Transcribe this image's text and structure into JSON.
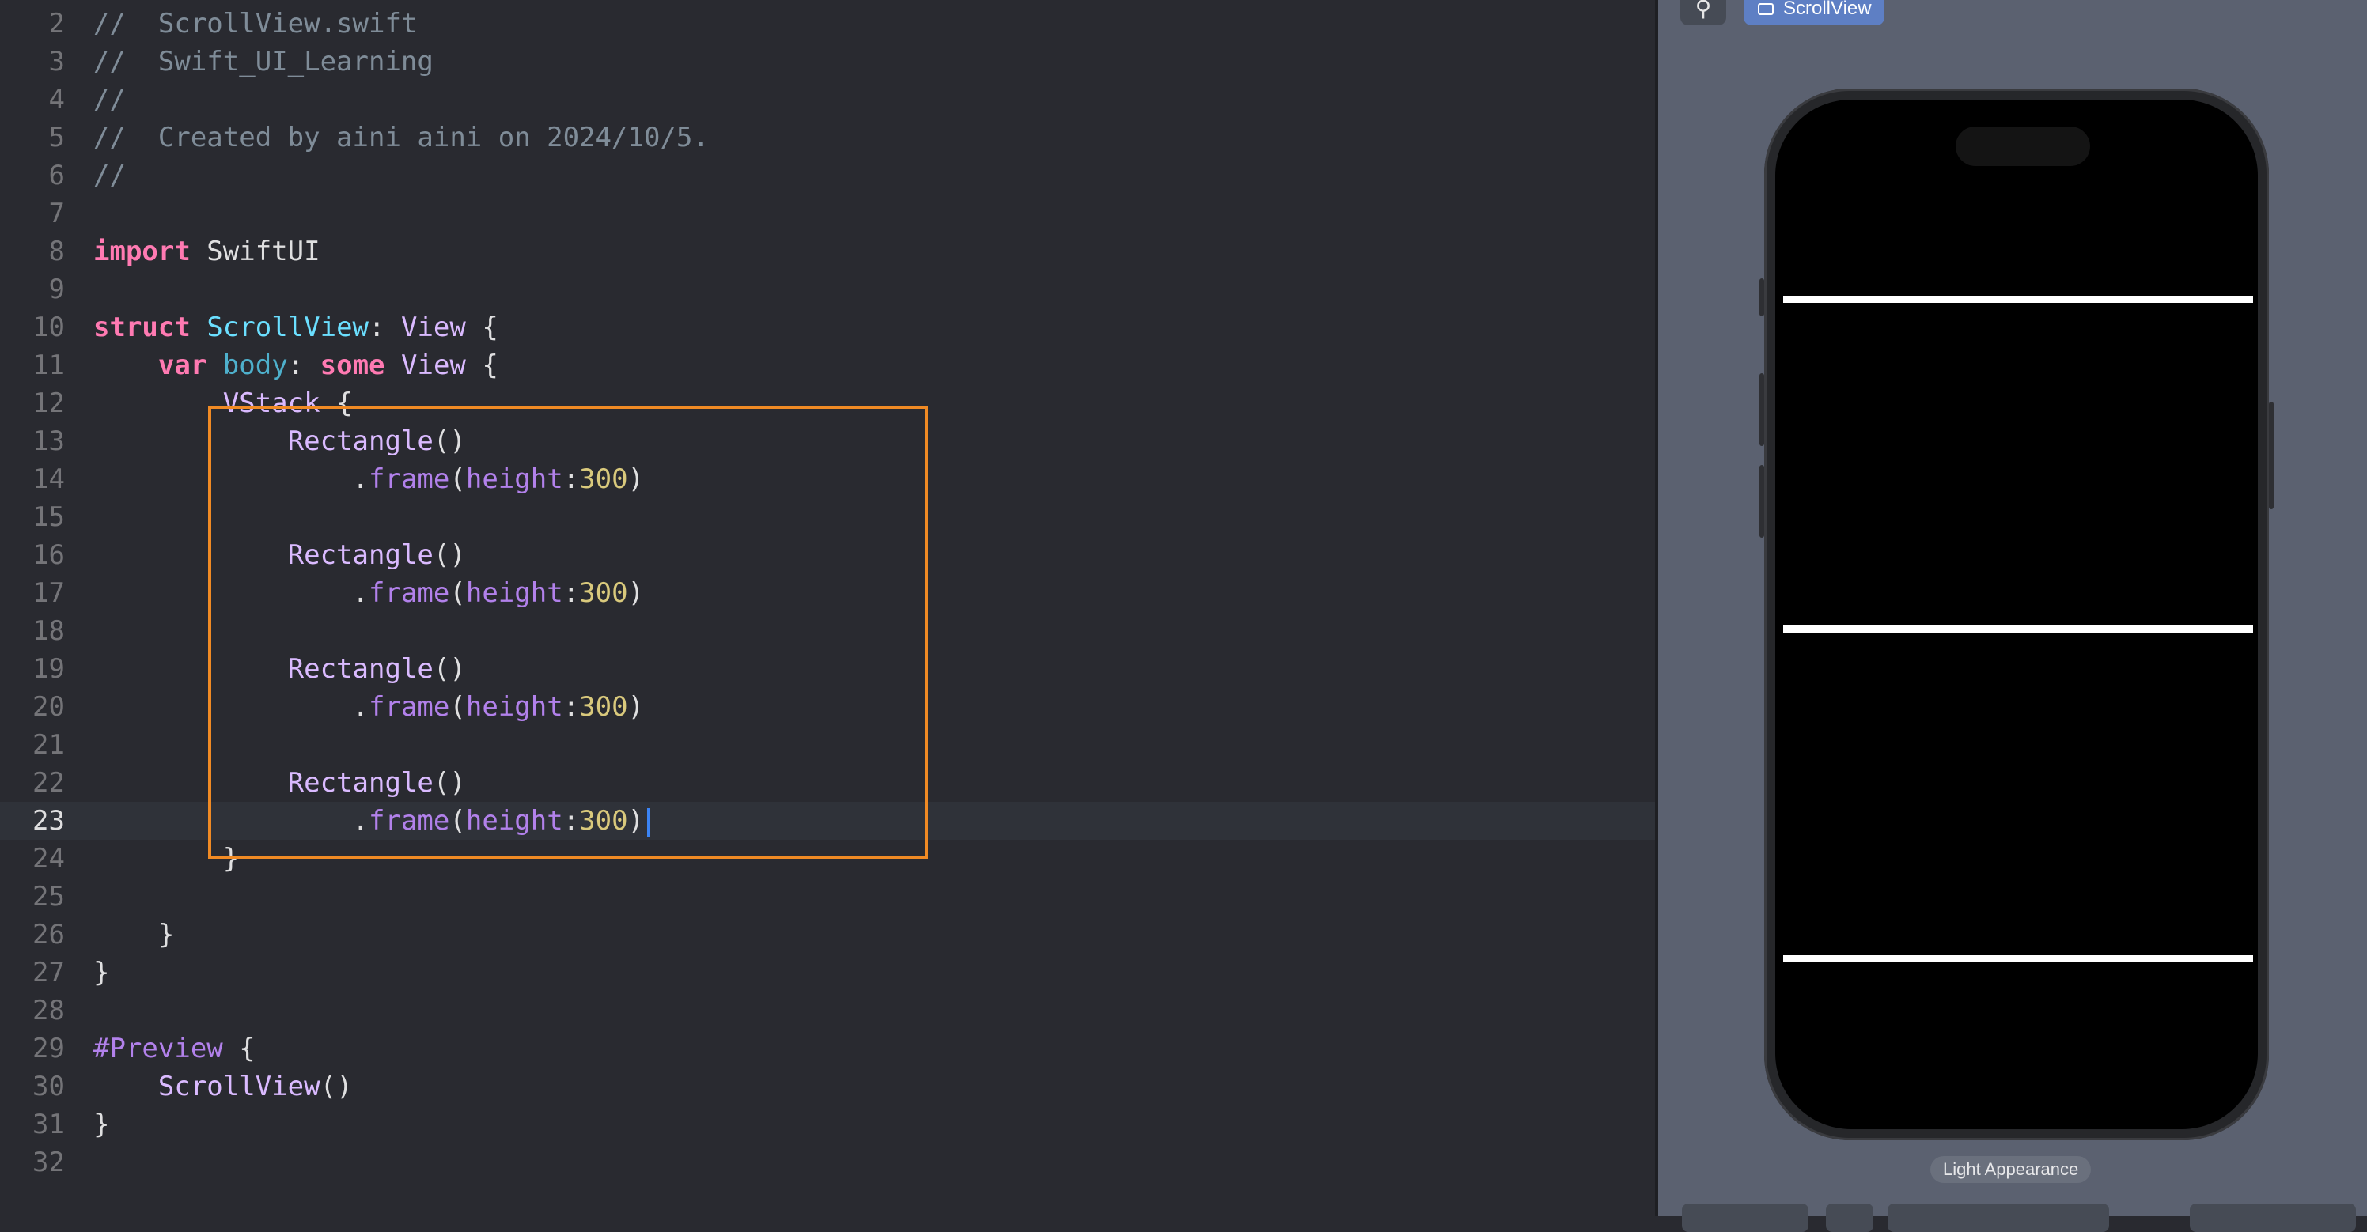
{
  "editor": {
    "current_line": "23",
    "lines": [
      {
        "n": "2",
        "tokens": [
          {
            "c": "t-comment",
            "t": "//  ScrollView.swift"
          }
        ]
      },
      {
        "n": "3",
        "tokens": [
          {
            "c": "t-comment",
            "t": "//  Swift_UI_Learning"
          }
        ]
      },
      {
        "n": "4",
        "tokens": [
          {
            "c": "t-comment",
            "t": "//"
          }
        ]
      },
      {
        "n": "5",
        "tokens": [
          {
            "c": "t-comment",
            "t": "//  Created by aini aini on 2024/10/5."
          }
        ]
      },
      {
        "n": "6",
        "tokens": [
          {
            "c": "t-comment",
            "t": "//"
          }
        ]
      },
      {
        "n": "7",
        "tokens": []
      },
      {
        "n": "8",
        "tokens": [
          {
            "c": "t-kw",
            "t": "import"
          },
          {
            "c": "t-plain",
            "t": " SwiftUI"
          }
        ]
      },
      {
        "n": "9",
        "tokens": []
      },
      {
        "n": "10",
        "tokens": [
          {
            "c": "t-kw",
            "t": "struct"
          },
          {
            "c": "t-plain",
            "t": " "
          },
          {
            "c": "t-type-decl",
            "t": "ScrollView"
          },
          {
            "c": "t-plain",
            "t": ": "
          },
          {
            "c": "t-type",
            "t": "View"
          },
          {
            "c": "t-plain",
            "t": " {"
          }
        ]
      },
      {
        "n": "11",
        "tokens": [
          {
            "c": "t-plain",
            "t": "    "
          },
          {
            "c": "t-kw",
            "t": "var"
          },
          {
            "c": "t-plain",
            "t": " "
          },
          {
            "c": "t-decl",
            "t": "body"
          },
          {
            "c": "t-plain",
            "t": ": "
          },
          {
            "c": "t-kw",
            "t": "some"
          },
          {
            "c": "t-plain",
            "t": " "
          },
          {
            "c": "t-type",
            "t": "View"
          },
          {
            "c": "t-plain",
            "t": " {"
          }
        ]
      },
      {
        "n": "12",
        "tokens": [
          {
            "c": "t-plain",
            "t": "        "
          },
          {
            "c": "t-type",
            "t": "VStack"
          },
          {
            "c": "t-plain",
            "t": " {"
          }
        ]
      },
      {
        "n": "13",
        "tokens": [
          {
            "c": "t-plain",
            "t": "            "
          },
          {
            "c": "t-type",
            "t": "Rectangle"
          },
          {
            "c": "t-plain",
            "t": "()"
          }
        ]
      },
      {
        "n": "14",
        "tokens": [
          {
            "c": "t-plain",
            "t": "                ."
          },
          {
            "c": "t-method",
            "t": "frame"
          },
          {
            "c": "t-plain",
            "t": "("
          },
          {
            "c": "t-param",
            "t": "height"
          },
          {
            "c": "t-plain",
            "t": ":"
          },
          {
            "c": "t-num",
            "t": "300"
          },
          {
            "c": "t-plain",
            "t": ")"
          }
        ]
      },
      {
        "n": "15",
        "tokens": []
      },
      {
        "n": "16",
        "tokens": [
          {
            "c": "t-plain",
            "t": "            "
          },
          {
            "c": "t-type",
            "t": "Rectangle"
          },
          {
            "c": "t-plain",
            "t": "()"
          }
        ]
      },
      {
        "n": "17",
        "tokens": [
          {
            "c": "t-plain",
            "t": "                ."
          },
          {
            "c": "t-method",
            "t": "frame"
          },
          {
            "c": "t-plain",
            "t": "("
          },
          {
            "c": "t-param",
            "t": "height"
          },
          {
            "c": "t-plain",
            "t": ":"
          },
          {
            "c": "t-num",
            "t": "300"
          },
          {
            "c": "t-plain",
            "t": ")"
          }
        ]
      },
      {
        "n": "18",
        "tokens": []
      },
      {
        "n": "19",
        "tokens": [
          {
            "c": "t-plain",
            "t": "            "
          },
          {
            "c": "t-type",
            "t": "Rectangle"
          },
          {
            "c": "t-plain",
            "t": "()"
          }
        ]
      },
      {
        "n": "20",
        "tokens": [
          {
            "c": "t-plain",
            "t": "                ."
          },
          {
            "c": "t-method",
            "t": "frame"
          },
          {
            "c": "t-plain",
            "t": "("
          },
          {
            "c": "t-param",
            "t": "height"
          },
          {
            "c": "t-plain",
            "t": ":"
          },
          {
            "c": "t-num",
            "t": "300"
          },
          {
            "c": "t-plain",
            "t": ")"
          }
        ]
      },
      {
        "n": "21",
        "tokens": []
      },
      {
        "n": "22",
        "tokens": [
          {
            "c": "t-plain",
            "t": "            "
          },
          {
            "c": "t-type",
            "t": "Rectangle"
          },
          {
            "c": "t-plain",
            "t": "()"
          }
        ]
      },
      {
        "n": "23",
        "tokens": [
          {
            "c": "t-plain",
            "t": "                ."
          },
          {
            "c": "t-method",
            "t": "frame"
          },
          {
            "c": "t-plain",
            "t": "("
          },
          {
            "c": "t-param",
            "t": "height"
          },
          {
            "c": "t-plain",
            "t": ":"
          },
          {
            "c": "t-num",
            "t": "300"
          },
          {
            "c": "t-plain",
            "t": ")"
          }
        ]
      },
      {
        "n": "24",
        "tokens": [
          {
            "c": "t-plain",
            "t": "        }"
          }
        ]
      },
      {
        "n": "25",
        "tokens": []
      },
      {
        "n": "26",
        "tokens": [
          {
            "c": "t-plain",
            "t": "    }"
          }
        ]
      },
      {
        "n": "27",
        "tokens": [
          {
            "c": "t-plain",
            "t": "}"
          }
        ]
      },
      {
        "n": "28",
        "tokens": []
      },
      {
        "n": "29",
        "tokens": [
          {
            "c": "t-macro",
            "t": "#Preview"
          },
          {
            "c": "t-plain",
            "t": " {"
          }
        ]
      },
      {
        "n": "30",
        "tokens": [
          {
            "c": "t-plain",
            "t": "    "
          },
          {
            "c": "t-type",
            "t": "ScrollView"
          },
          {
            "c": "t-plain",
            "t": "()"
          }
        ]
      },
      {
        "n": "31",
        "tokens": [
          {
            "c": "t-plain",
            "t": "}"
          }
        ]
      },
      {
        "n": "32",
        "tokens": []
      }
    ]
  },
  "preview": {
    "pin_icon": "pin-icon",
    "pin_glyph": "⚲",
    "tab_label": "ScrollView",
    "tab_icon": "window-icon",
    "appearance_label": "Light Appearance",
    "dividers": 3
  },
  "colors": {
    "editor_background": "#292a30",
    "canvas_background": "#5b6170",
    "selection_border": "#f08a24",
    "caret": "#3b84f5",
    "active_tab": "#5e7fc4"
  }
}
